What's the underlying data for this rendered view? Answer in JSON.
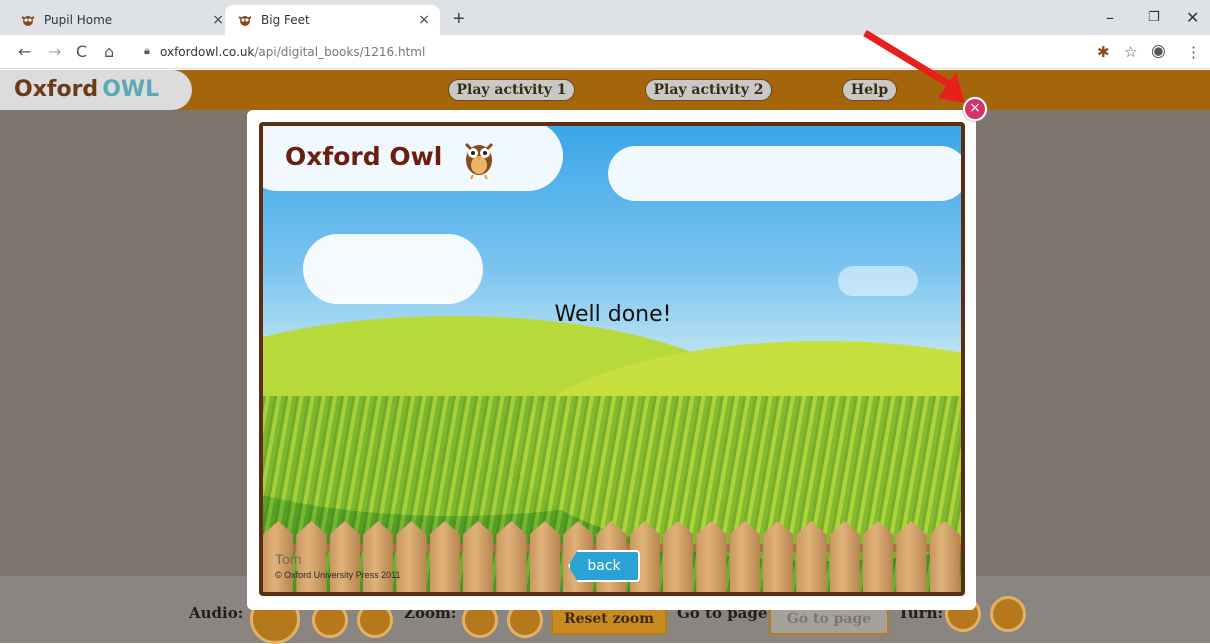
{
  "browser": {
    "tabs": [
      {
        "title": "Pupil Home",
        "active": false
      },
      {
        "title": "Big Feet",
        "active": true
      }
    ],
    "new_tab_symbol": "+",
    "tab_close_symbol": "×",
    "url_host": "oxfordowl.co.uk",
    "url_path": "/api/digital_books/1216.html",
    "window_controls": {
      "minimize": "–",
      "restore": "❐",
      "close": "✕"
    }
  },
  "site": {
    "logo_text": "Oxford",
    "logo_text_2": "OWL",
    "nav": [
      {
        "label": "Play activity 1"
      },
      {
        "label": "Play activity 2"
      },
      {
        "label": "Help"
      }
    ]
  },
  "modal": {
    "brand": "Oxford Owl",
    "message": "Well done!",
    "back_label": "back",
    "author": "Tom",
    "copyright": "© Oxford University Press 2011",
    "close_symbol": "×"
  },
  "controls": {
    "audio_label": "Audio:",
    "zoom_label": "Zoom:",
    "reset_zoom_label": "Reset zoom",
    "go_to_page_label": "Go to page:",
    "go_to_page_button": "Go to page",
    "turn_label": "Turn:"
  },
  "colors": {
    "site_bar": "#a4650b",
    "close_button": "#d6336c",
    "back_button": "#2ba2d6",
    "annotation_arrow": "#e8201c"
  }
}
